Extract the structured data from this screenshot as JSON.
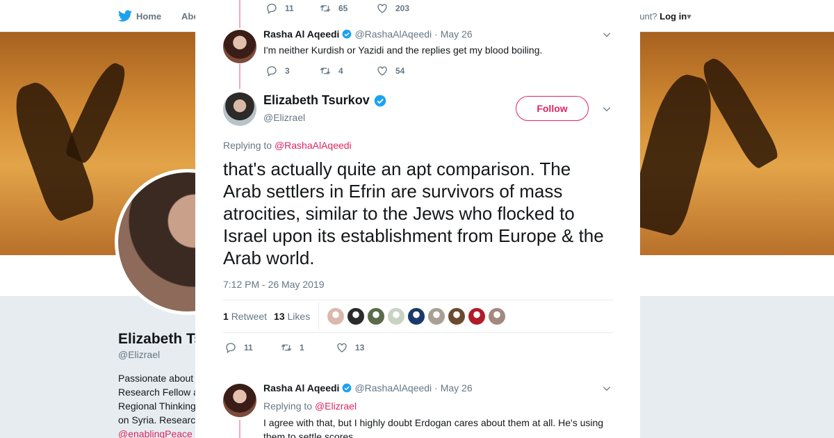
{
  "nav": {
    "home_label": "Home",
    "about_label": "Abo",
    "account_prompt": "ccount?",
    "login_label": "Log in"
  },
  "profile": {
    "name": "Elizabeth Ts",
    "handle": "@Elizrael",
    "bio_lines": [
      "Passionate about",
      "Research Fellow a",
      "Regional Thinking",
      "on Syria. Researc"
    ],
    "bio_link": "@enablingPeace"
  },
  "modal": {
    "top_actions": {
      "replies": "11",
      "retweets": "65",
      "likes": "203"
    },
    "tweet1": {
      "name": "Rasha Al Aqeedi",
      "handle": "@RashaAlAqeedi",
      "date": "· May 26",
      "text": "I'm neither Kurdish or Yazidi and the replies get my blood boiling.",
      "replies": "3",
      "retweets": "4",
      "likes": "54"
    },
    "main": {
      "name": "Elizabeth Tsurkov",
      "handle": "@Elizrael",
      "follow_label": "Follow",
      "replying_prefix": "Replying to",
      "replying_to": "@RashaAlAqeedi",
      "text": "that's actually quite an apt comparison. The Arab settlers in Efrin are survivors of mass atrocities, similar to the Jews who flocked to Israel upon its establishment from Europe & the Arab world.",
      "timestamp": "7:12 PM - 26 May 2019",
      "retweet_count": "1",
      "retweet_label": "Retweet",
      "like_count": "13",
      "like_label": "Likes",
      "replies": "11",
      "retweets": "1",
      "likes": "13",
      "liker_colors": [
        "#d9b9ac",
        "#2b2b2b",
        "#5a6b4a",
        "#c9d3c2",
        "#1a3a6a",
        "#a99f94",
        "#6b4a30",
        "#b01c2a",
        "#a3887f"
      ]
    },
    "tweet2": {
      "name": "Rasha Al Aqeedi",
      "handle": "@RashaAlAqeedi",
      "date": "· May 26",
      "replying_prefix": "Replying to",
      "replying_to": "@Elizrael",
      "text": "I agree with that, but I highly doubt Erdogan cares about them at all. He's using them to settle scores."
    }
  },
  "colors": {
    "accent": "#e0245e",
    "verified": "#1da1f2",
    "muted": "#657786"
  }
}
